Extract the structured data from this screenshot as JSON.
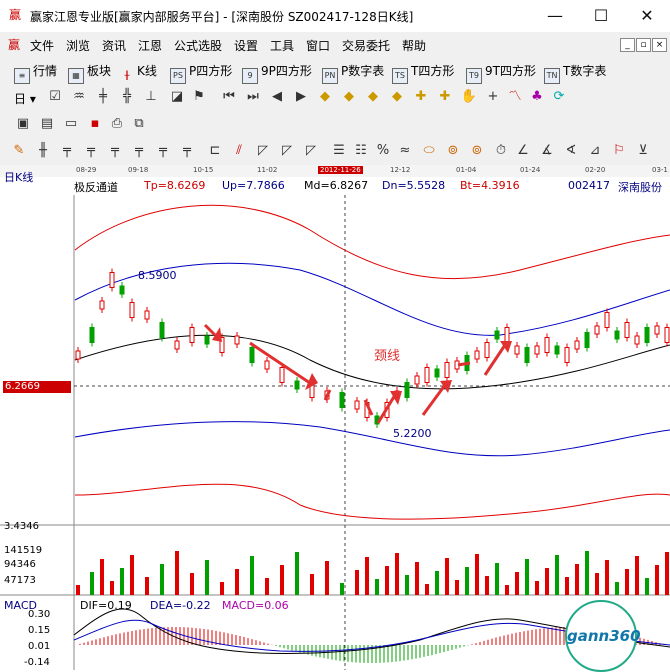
{
  "window": {
    "title": "赢家江恩专业版[赢家内部服务平台] - [深南股份  SZ002417-128日K线]",
    "minimize": "—",
    "maximize": "☐",
    "close": "✕"
  },
  "menu": {
    "items": [
      "文件",
      "浏览",
      "资讯",
      "江恩",
      "公式选股",
      "设置",
      "工具",
      "窗口",
      "交易委托",
      "帮助"
    ]
  },
  "toolbar1": {
    "items": [
      "行情",
      "板块",
      "K线",
      "P四方形",
      "9P四方形",
      "P数字表",
      "T四方形",
      "9T四方形",
      "T数字表"
    ],
    "icons": [
      "PS",
      "9",
      "PN",
      "TS",
      "T9",
      "TN"
    ]
  },
  "toolbar2": {
    "label": "日"
  },
  "datebar": {
    "dates": [
      "08-29",
      "09-18",
      "10-15",
      "11-02",
      "2012-11-26",
      "12-12",
      "01-04",
      "01-24",
      "02-20",
      "03-1"
    ]
  },
  "info": {
    "chart_type": "日K线",
    "indicator": "极反通道",
    "tp": "Tp=8.6269",
    "up": "Up=7.7866",
    "md": "Md=6.8267",
    "dn": "Dn=5.5528",
    "bt": "Bt=4.3916",
    "code": "002417",
    "name": "深南股份"
  },
  "chart": {
    "price_tag": "6.2669",
    "high_label": "8.5900",
    "low_label": "5.2200",
    "neckline_label": "颈线",
    "volume_ticks": [
      "3.4346",
      "141519",
      "94346",
      "47173"
    ],
    "colors": {
      "up": "#e00000",
      "down": "#00a000",
      "upper_band": "#e00000",
      "mid_band": "#000080",
      "mid_line": "#000000",
      "arrow": "#e03030"
    }
  },
  "macd": {
    "label": "MACD",
    "dif": "DIF=0.19",
    "dea": "DEA=-0.22",
    "macd": "MACD=0.06",
    "ticks": [
      "0.30",
      "0.15",
      "0.01",
      "-0.14"
    ]
  },
  "watermark": {
    "text": "gann360"
  }
}
